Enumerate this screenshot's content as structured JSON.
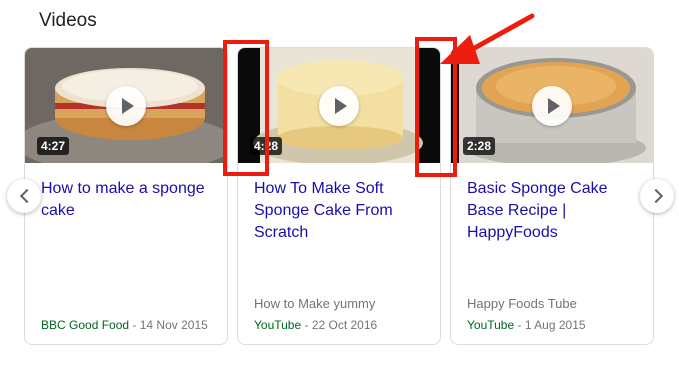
{
  "section_title": "Videos",
  "videos": [
    {
      "duration": "4:27",
      "title": "How to make a sponge cake",
      "channel": "",
      "source": "BBC Good Food",
      "date": "14 Nov 2015"
    },
    {
      "duration": "4:28",
      "title": "How To Make Soft Sponge Cake From Scratch",
      "channel": "How to Make yummy",
      "source": "YouTube",
      "date": "22 Oct 2016"
    },
    {
      "duration": "2:28",
      "title": "Basic Sponge Cake Base Recipe | HappyFoods",
      "channel": "Happy Foods Tube",
      "source": "YouTube",
      "date": "1 Aug 2015"
    }
  ],
  "separator": " - ",
  "icons": {
    "play": "play-icon",
    "prev": "chevron-left-icon",
    "next": "chevron-right-icon",
    "annotation_arrow": "red-arrow-icon"
  },
  "colors": {
    "link": "#1a0dab",
    "source": "#006621",
    "annotation": "#ee1c0c"
  }
}
